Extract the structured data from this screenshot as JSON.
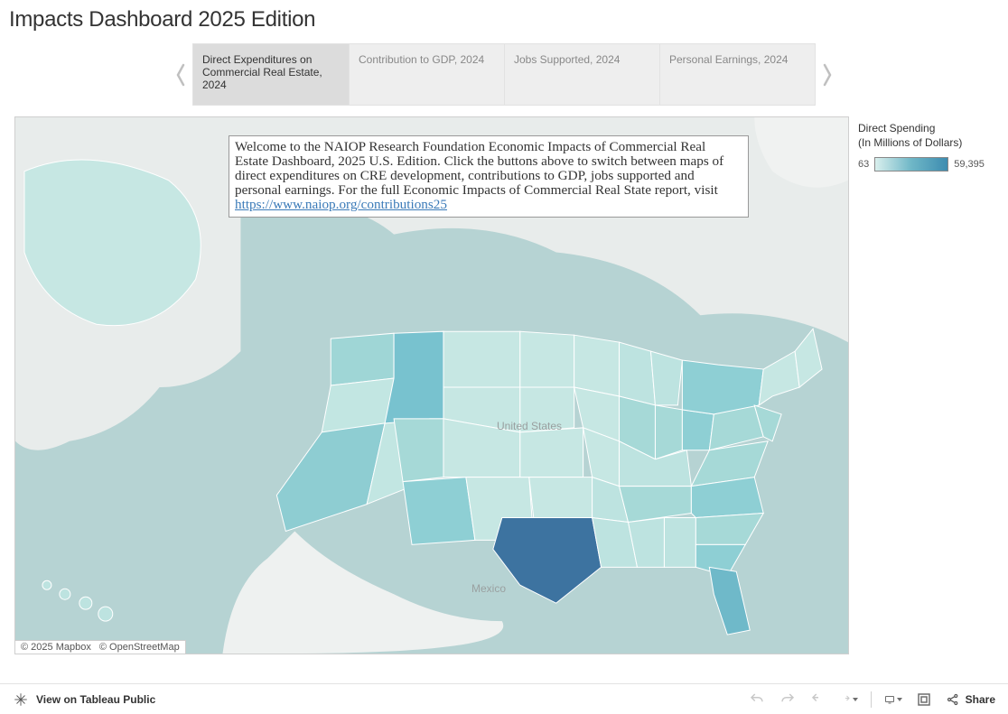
{
  "title": "Impacts Dashboard 2025 Edition",
  "tabs": [
    "Direct Expenditures on Commercial Real Estate, 2024",
    "Contribution to GDP, 2024",
    "Jobs Supported, 2024",
    "Personal Earnings, 2024"
  ],
  "welcome_text_before_link": "Welcome to the NAIOP Research Foundation Economic Impacts of Commercial Real Estate Dashboard, 2025 U.S. Edition. Click the buttons above to switch between maps of direct expenditures on CRE development, contributions to GDP, jobs supported and personal earnings. For the full Economic Impacts of Commercial Real State report, visit ",
  "welcome_link_text": "https://www.naiop.org/contributions25",
  "map_attrib_1": "© 2025 Mapbox",
  "map_attrib_2": "© OpenStreetMap",
  "map_label_country": "United States",
  "map_label_mexico": "Mexico",
  "legend": {
    "title_line1": "Direct Spending",
    "title_line2": "(In Millions of Dollars)",
    "min": "63",
    "max": "59,395"
  },
  "footer": {
    "view_label": "View on Tableau Public",
    "share_label": "Share"
  }
}
